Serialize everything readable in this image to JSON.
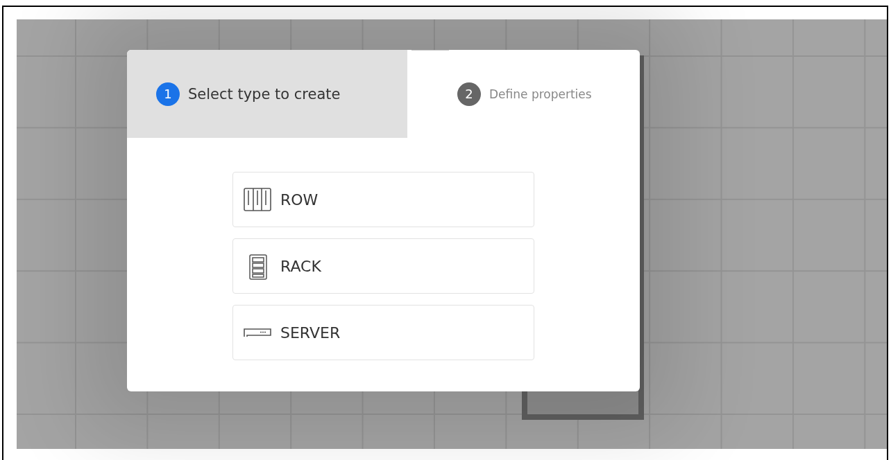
{
  "dialog": {
    "steps": [
      {
        "number": "1",
        "label": "Select type to create",
        "selected": true
      },
      {
        "number": "2",
        "label": "Define properties",
        "selected": false
      }
    ],
    "options": [
      {
        "kind": "row",
        "label": "ROW"
      },
      {
        "kind": "rack",
        "label": "RACK"
      },
      {
        "kind": "server",
        "label": "SERVER"
      }
    ]
  }
}
